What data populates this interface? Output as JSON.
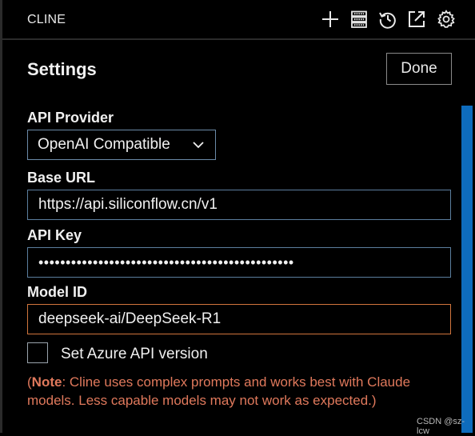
{
  "titlebar": {
    "title": "CLINE",
    "icons": [
      "plus-icon",
      "server-icon",
      "history-icon",
      "external-link-icon",
      "gear-icon"
    ]
  },
  "settings": {
    "heading": "Settings",
    "done_label": "Done"
  },
  "api_provider": {
    "label": "API Provider",
    "selected": "OpenAI Compatible"
  },
  "base_url": {
    "label": "Base URL",
    "value": "https://api.siliconflow.cn/v1"
  },
  "api_key": {
    "label": "API Key",
    "value": "•••••••••••••••••••••••••••••••••••••••••••••••"
  },
  "model_id": {
    "label": "Model ID",
    "value": "deepseek-ai/DeepSeek-R1"
  },
  "azure": {
    "label": "Set Azure API version",
    "checked": false
  },
  "note": {
    "open_paren": "(",
    "bold": "Note",
    "text": ": Cline uses complex prompts and works best with Claude models. Less capable models may not work as expected.)"
  },
  "watermark": "CSDN @sz-lcw",
  "colors": {
    "accent": "#0e6cbd",
    "focus_border": "#d1753d",
    "note": "#e0795c"
  }
}
